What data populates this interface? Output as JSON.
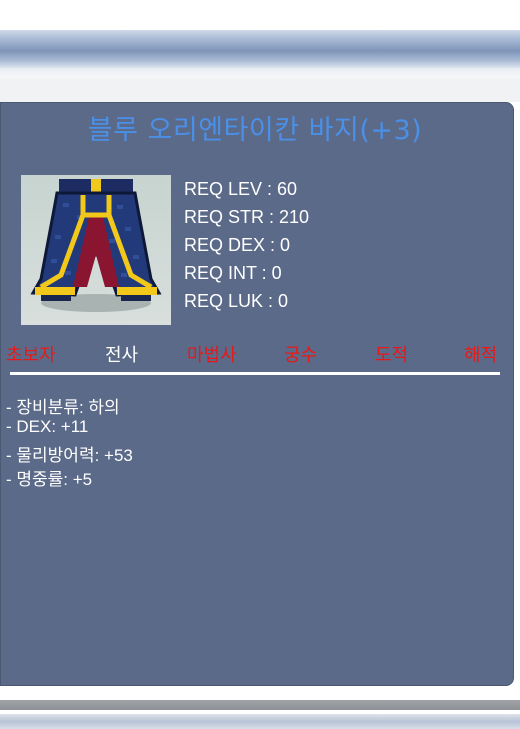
{
  "item": {
    "name": "블루 오리엔타이칸 바지(+3)",
    "icon": "pants-icon"
  },
  "requirements": [
    "REQ LEV : 60",
    "REQ STR : 210",
    "REQ DEX : 0",
    "REQ INT : 0",
    "REQ LUK : 0"
  ],
  "jobs": [
    {
      "label": "초보자",
      "available": false
    },
    {
      "label": "전사",
      "available": true
    },
    {
      "label": "마법사",
      "available": false
    },
    {
      "label": "궁수",
      "available": false
    },
    {
      "label": "도적",
      "available": false
    },
    {
      "label": "해적",
      "available": false
    }
  ],
  "stats": [
    "- 장비분류: 하의",
    "- DEX: +11",
    "- 물리방어력: +53",
    "- 명중률: +5"
  ],
  "colors": {
    "panel": "#5b6a88",
    "title": "#4a90e8",
    "unavailable_job": "#e81818",
    "available_job": "#ffffff"
  }
}
